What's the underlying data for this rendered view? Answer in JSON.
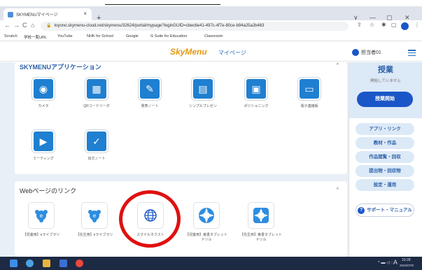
{
  "browser": {
    "tab_title": "SKYMENUマイページ",
    "tab_close": "×",
    "new_tab": "+",
    "win_min": "—",
    "win_max": "▢",
    "win_close": "✕",
    "win_chevron": "∨",
    "nav_back": "←",
    "nav_forward": "→",
    "nav_reload": "C",
    "nav_home": "⌂",
    "url": "toyono.skymenu-cloud.net/skymenu/32624/portal/mypage?loginGUID=cbec6e41-497c-4f7e-80ce-b94a25a2b463",
    "bookmarks": [
      "Scratch",
      "学校一覧URL",
      "YouTube",
      "NHK for School",
      "Google",
      "G Suite for Education",
      "Classroom"
    ]
  },
  "header": {
    "logo": "SkyMenu",
    "page_label": "マイページ",
    "user": "担当者01"
  },
  "apps_section": {
    "title": "SKYMENUアプリケーション",
    "collapse_icon": "^",
    "items": [
      {
        "label": "カメラ",
        "icon": "camera-icon",
        "glyph": "◉"
      },
      {
        "label": "QRコードリーダ",
        "icon": "qr-reader-icon",
        "glyph": "▦"
      },
      {
        "label": "発表ノート",
        "icon": "presentation-note-icon",
        "glyph": "✎"
      },
      {
        "label": "シンプルプレゼン",
        "icon": "simple-presen-icon",
        "glyph": "▤"
      },
      {
        "label": "ポジショニング",
        "icon": "positioning-icon",
        "glyph": "▣"
      },
      {
        "label": "電子連絡帳",
        "icon": "contact-book-icon",
        "glyph": "▭"
      },
      {
        "label": "ミーティング",
        "icon": "meeting-icon",
        "glyph": "▶"
      },
      {
        "label": "出欠ノート",
        "icon": "attendance-note-icon",
        "glyph": "✓"
      }
    ]
  },
  "web_section": {
    "title": "Webページのリンク",
    "collapse_icon": "^",
    "items": [
      {
        "label": "【児童用】eライブラリ",
        "icon": "e-library-student-icon"
      },
      {
        "label": "【先生用】eライブラリ",
        "icon": "e-library-teacher-icon"
      },
      {
        "label": "スマイルネクスト",
        "icon": "globe-icon"
      },
      {
        "label": "【児童用】東書タブレットドリル",
        "icon": "tablet-drill-student-icon"
      },
      {
        "label": "【先生用】東書タブレットドリル",
        "icon": "tablet-drill-teacher-icon"
      }
    ]
  },
  "sidebar": {
    "lesson_title": "授業",
    "lesson_status": "開始していません",
    "lesson_start": "授業開始",
    "buttons": [
      "アプリ・リンク",
      "教材・作品",
      "作品閲覧・回収",
      "提出物・回収物",
      "設定・運用"
    ],
    "support": "サポート・マニュアル"
  },
  "taskbar": {
    "clock_time": "10:28",
    "clock_date": "2022/07/0",
    "ime": "A"
  },
  "colors": {
    "accent": "#1a56c7",
    "highlight_ring": "#e01010",
    "app_tile": "#1f7fd0"
  }
}
